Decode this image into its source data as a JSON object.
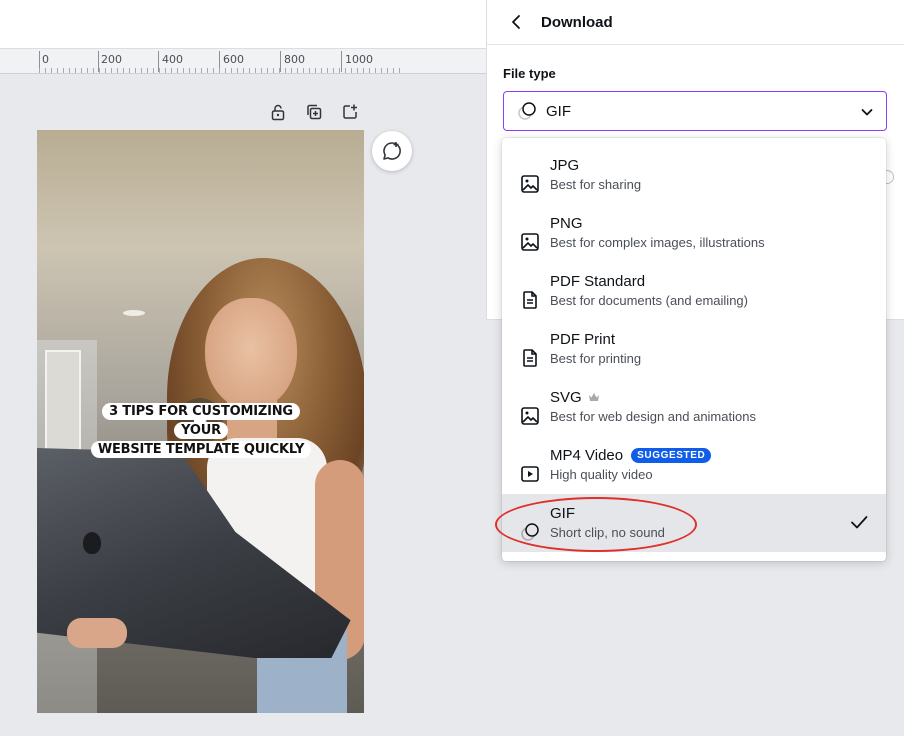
{
  "ruler": {
    "labels": [
      "0",
      "200",
      "400",
      "600",
      "800",
      "1000"
    ]
  },
  "canvas_tools": [
    "lock-icon",
    "duplicate-page-icon",
    "add-page-icon"
  ],
  "video": {
    "caption_line1": "3 TIPS FOR CUSTOMIZING YOUR",
    "caption_line2": "WEBSITE TEMPLATE QUICKLY"
  },
  "download_panel": {
    "title": "Download",
    "file_type_label": "File type",
    "selected_value": "GIF"
  },
  "options": [
    {
      "title": "JPG",
      "desc": "Best for sharing",
      "icon": "image-icon"
    },
    {
      "title": "PNG",
      "desc": "Best for complex images, illustrations",
      "icon": "image-icon"
    },
    {
      "title": "PDF Standard",
      "desc": "Best for documents (and emailing)",
      "icon": "document-icon"
    },
    {
      "title": "PDF Print",
      "desc": "Best for printing",
      "icon": "document-icon"
    },
    {
      "title": "SVG",
      "desc": "Best for web design and animations",
      "icon": "image-icon",
      "pro": true
    },
    {
      "title": "MP4 Video",
      "desc": "High quality video",
      "icon": "video-icon",
      "badge": "SUGGESTED"
    },
    {
      "title": "GIF",
      "desc": "Short clip, no sound",
      "icon": "gif-icon",
      "selected": true
    }
  ],
  "colors": {
    "accent": "#8b3dff",
    "badge": "#0f5de8",
    "highlight_ring": "#e0302a"
  }
}
